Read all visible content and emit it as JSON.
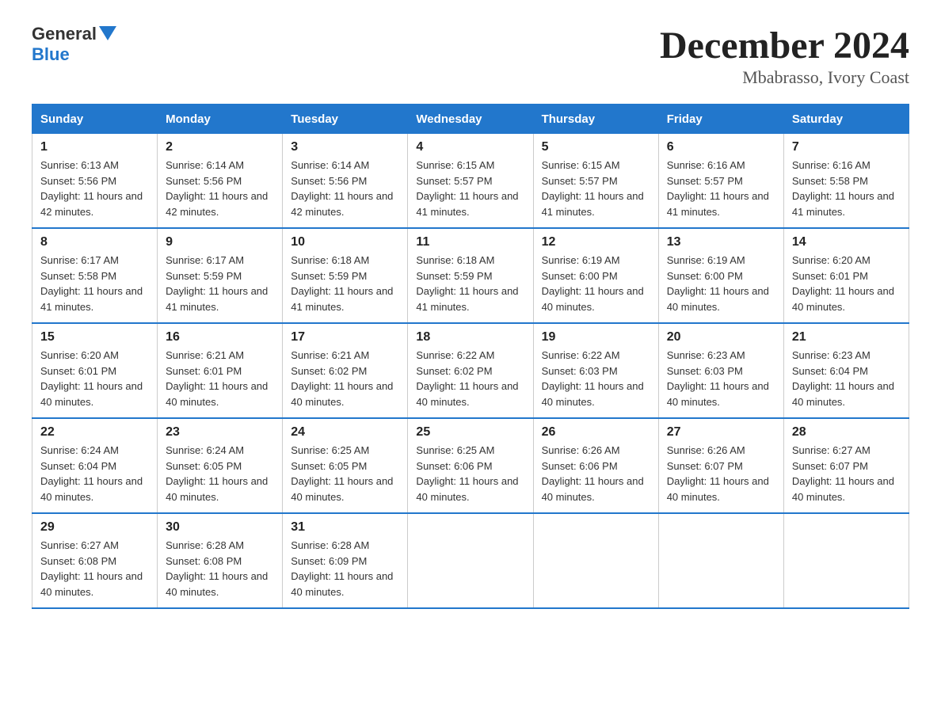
{
  "logo": {
    "general": "General",
    "blue": "Blue"
  },
  "title": "December 2024",
  "location": "Mbabrasso, Ivory Coast",
  "days_of_week": [
    "Sunday",
    "Monday",
    "Tuesday",
    "Wednesday",
    "Thursday",
    "Friday",
    "Saturday"
  ],
  "weeks": [
    [
      {
        "day": "1",
        "sunrise": "6:13 AM",
        "sunset": "5:56 PM",
        "daylight": "11 hours and 42 minutes."
      },
      {
        "day": "2",
        "sunrise": "6:14 AM",
        "sunset": "5:56 PM",
        "daylight": "11 hours and 42 minutes."
      },
      {
        "day": "3",
        "sunrise": "6:14 AM",
        "sunset": "5:56 PM",
        "daylight": "11 hours and 42 minutes."
      },
      {
        "day": "4",
        "sunrise": "6:15 AM",
        "sunset": "5:57 PM",
        "daylight": "11 hours and 41 minutes."
      },
      {
        "day": "5",
        "sunrise": "6:15 AM",
        "sunset": "5:57 PM",
        "daylight": "11 hours and 41 minutes."
      },
      {
        "day": "6",
        "sunrise": "6:16 AM",
        "sunset": "5:57 PM",
        "daylight": "11 hours and 41 minutes."
      },
      {
        "day": "7",
        "sunrise": "6:16 AM",
        "sunset": "5:58 PM",
        "daylight": "11 hours and 41 minutes."
      }
    ],
    [
      {
        "day": "8",
        "sunrise": "6:17 AM",
        "sunset": "5:58 PM",
        "daylight": "11 hours and 41 minutes."
      },
      {
        "day": "9",
        "sunrise": "6:17 AM",
        "sunset": "5:59 PM",
        "daylight": "11 hours and 41 minutes."
      },
      {
        "day": "10",
        "sunrise": "6:18 AM",
        "sunset": "5:59 PM",
        "daylight": "11 hours and 41 minutes."
      },
      {
        "day": "11",
        "sunrise": "6:18 AM",
        "sunset": "5:59 PM",
        "daylight": "11 hours and 41 minutes."
      },
      {
        "day": "12",
        "sunrise": "6:19 AM",
        "sunset": "6:00 PM",
        "daylight": "11 hours and 40 minutes."
      },
      {
        "day": "13",
        "sunrise": "6:19 AM",
        "sunset": "6:00 PM",
        "daylight": "11 hours and 40 minutes."
      },
      {
        "day": "14",
        "sunrise": "6:20 AM",
        "sunset": "6:01 PM",
        "daylight": "11 hours and 40 minutes."
      }
    ],
    [
      {
        "day": "15",
        "sunrise": "6:20 AM",
        "sunset": "6:01 PM",
        "daylight": "11 hours and 40 minutes."
      },
      {
        "day": "16",
        "sunrise": "6:21 AM",
        "sunset": "6:01 PM",
        "daylight": "11 hours and 40 minutes."
      },
      {
        "day": "17",
        "sunrise": "6:21 AM",
        "sunset": "6:02 PM",
        "daylight": "11 hours and 40 minutes."
      },
      {
        "day": "18",
        "sunrise": "6:22 AM",
        "sunset": "6:02 PM",
        "daylight": "11 hours and 40 minutes."
      },
      {
        "day": "19",
        "sunrise": "6:22 AM",
        "sunset": "6:03 PM",
        "daylight": "11 hours and 40 minutes."
      },
      {
        "day": "20",
        "sunrise": "6:23 AM",
        "sunset": "6:03 PM",
        "daylight": "11 hours and 40 minutes."
      },
      {
        "day": "21",
        "sunrise": "6:23 AM",
        "sunset": "6:04 PM",
        "daylight": "11 hours and 40 minutes."
      }
    ],
    [
      {
        "day": "22",
        "sunrise": "6:24 AM",
        "sunset": "6:04 PM",
        "daylight": "11 hours and 40 minutes."
      },
      {
        "day": "23",
        "sunrise": "6:24 AM",
        "sunset": "6:05 PM",
        "daylight": "11 hours and 40 minutes."
      },
      {
        "day": "24",
        "sunrise": "6:25 AM",
        "sunset": "6:05 PM",
        "daylight": "11 hours and 40 minutes."
      },
      {
        "day": "25",
        "sunrise": "6:25 AM",
        "sunset": "6:06 PM",
        "daylight": "11 hours and 40 minutes."
      },
      {
        "day": "26",
        "sunrise": "6:26 AM",
        "sunset": "6:06 PM",
        "daylight": "11 hours and 40 minutes."
      },
      {
        "day": "27",
        "sunrise": "6:26 AM",
        "sunset": "6:07 PM",
        "daylight": "11 hours and 40 minutes."
      },
      {
        "day": "28",
        "sunrise": "6:27 AM",
        "sunset": "6:07 PM",
        "daylight": "11 hours and 40 minutes."
      }
    ],
    [
      {
        "day": "29",
        "sunrise": "6:27 AM",
        "sunset": "6:08 PM",
        "daylight": "11 hours and 40 minutes."
      },
      {
        "day": "30",
        "sunrise": "6:28 AM",
        "sunset": "6:08 PM",
        "daylight": "11 hours and 40 minutes."
      },
      {
        "day": "31",
        "sunrise": "6:28 AM",
        "sunset": "6:09 PM",
        "daylight": "11 hours and 40 minutes."
      },
      null,
      null,
      null,
      null
    ]
  ],
  "labels": {
    "sunrise_prefix": "Sunrise: ",
    "sunset_prefix": "Sunset: ",
    "daylight_prefix": "Daylight: "
  }
}
